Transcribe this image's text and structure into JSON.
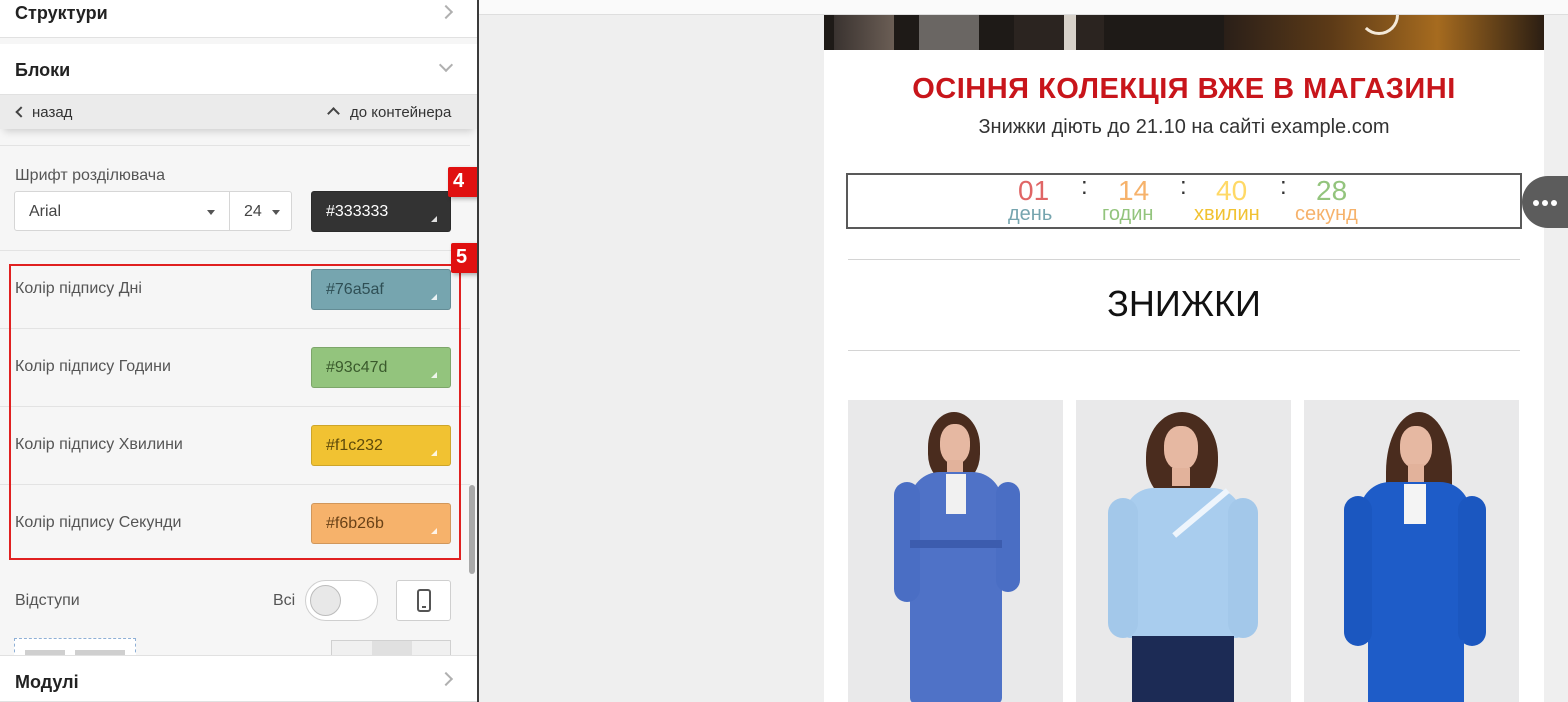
{
  "panel": {
    "sections": {
      "structures": "Структури",
      "blocks": "Блоки",
      "modules": "Модулі"
    },
    "nav": {
      "back": "назад",
      "to_container": "до контейнера"
    },
    "separator_font": {
      "label": "Шрифт розділювача",
      "family": "Arial",
      "size": "24",
      "color": "#333333",
      "color_hex": "#333333"
    },
    "label_colors": [
      {
        "label": "Колір підпису Дні",
        "value": "#76a5af",
        "hex": "#76a5af"
      },
      {
        "label": "Колір підпису Години",
        "value": "#93c47d",
        "hex": "#93c47d"
      },
      {
        "label": "Колір підпису Хвилини",
        "value": "#f1c232",
        "hex": "#f1c232"
      },
      {
        "label": "Колір підпису Секунди",
        "value": "#f6b26b",
        "hex": "#f6b26b"
      }
    ],
    "padding": {
      "label": "Відступи",
      "all_label": "Всі",
      "toggle_on": false
    },
    "badges": [
      "4",
      "5"
    ],
    "icons": {
      "chevron_right": "chevron-right-icon",
      "chevron_down": "chevron-down-icon",
      "back": "chevron-left-icon",
      "up": "chevron-up-icon",
      "device": "mobile-icon",
      "more": "more-icon"
    }
  },
  "email": {
    "headline": "ОСІННЯ КОЛЕКЦІЯ ВЖЕ В МАГАЗИНІ",
    "subline": "Знижки діють до 21.10 на сайті example.com",
    "timer": {
      "separator": ":",
      "parts": [
        {
          "num": "01",
          "unit": "день",
          "num_color": "#e06666",
          "unit_color": "#76a5af"
        },
        {
          "num": "14",
          "unit": "годин",
          "num_color": "#f6b26b",
          "unit_color": "#93c47d"
        },
        {
          "num": "40",
          "unit": "хвилин",
          "num_color": "#ffd966",
          "unit_color": "#f1c232"
        },
        {
          "num": "28",
          "unit": "секунд",
          "num_color": "#93c47d",
          "unit_color": "#f6b26b"
        }
      ]
    },
    "section_title": "ЗНИЖКИ"
  }
}
